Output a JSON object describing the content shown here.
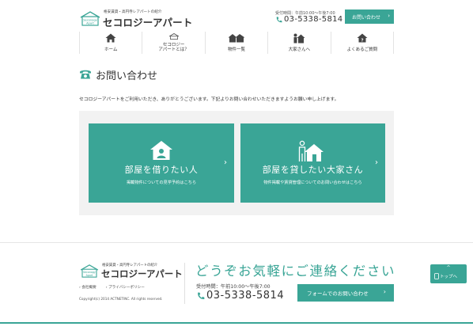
{
  "header": {
    "logo_tag": "格安賃貸・高円寺レアパートの紹介",
    "logo_mark_text": "Seconogy Apart",
    "logo_text": "セコロジーアパート",
    "hours": "受付時間：午前10:00〜午後7:00",
    "phone": "03-5338-5814",
    "contact_button": "お問い合わせ",
    "icons": {
      "phone": "phone-icon",
      "chevron": "chevron-right-icon"
    }
  },
  "nav": [
    {
      "label": "ホーム",
      "icon": "home-icon"
    },
    {
      "label": "セコロジー\nアパートとは？",
      "icon": "house-logo-icon"
    },
    {
      "label": "物件一覧",
      "icon": "buildings-icon"
    },
    {
      "label": "大家さんへ",
      "icon": "landlord-icon"
    },
    {
      "label": "よくあるご質問",
      "icon": "faq-house-icon"
    }
  ],
  "page": {
    "title": "お問い合わせ",
    "title_icon": "telephone-icon",
    "intro": "セコロジーアパートをご利用いただき、ありがとうございます。下記よりお問い合わせいただきますようお願い申し上げます。"
  },
  "cards": [
    {
      "title": "部屋を借りたい人",
      "subtitle": "掲載物件についての見学予約はこちら",
      "icon": "tenant-house-icon"
    },
    {
      "title": "部屋を貸したい大家さん",
      "subtitle": "物件掲載や賃貸管理についてのお問い合わせはこちら",
      "icon": "landlord-house-icon"
    }
  ],
  "footer": {
    "logo_tag": "格安賃貸・高円寺レアパートの紹介",
    "logo_text": "セコロジーアパート",
    "links": [
      "会社概要",
      "プライバシーポリシー"
    ],
    "copyright": "Copyright(c) 2014 ACTNETINC. All rights reserved.",
    "headline": "どうぞお気軽にご連絡ください",
    "hours": "受付時間：午前10:00〜午後7:00",
    "phone": "03-5338-5814",
    "form_button": "フォームでのお問い合わせ",
    "to_top": "トップへ"
  },
  "colors": {
    "accent": "#3aa596",
    "panel": "#f2f2f2",
    "text": "#333333"
  }
}
